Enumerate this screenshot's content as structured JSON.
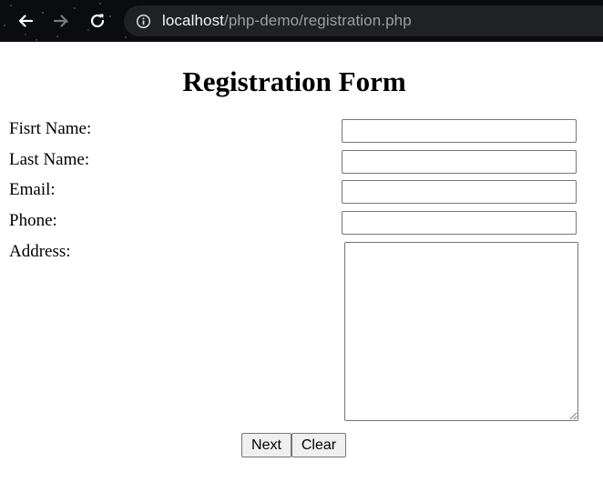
{
  "browser": {
    "url_host": "localhost",
    "url_path": "/php-demo/registration.php"
  },
  "form": {
    "title": "Registration Form",
    "fields": [
      {
        "label": "Fisrt Name:",
        "value": ""
      },
      {
        "label": "Last Name:",
        "value": ""
      },
      {
        "label": "Email:",
        "value": ""
      },
      {
        "label": "Phone:",
        "value": ""
      }
    ],
    "address": {
      "label": "Address:",
      "value": ""
    },
    "buttons": {
      "next": "Next",
      "clear": "Clear"
    }
  },
  "icons": {
    "back": "arrow-left-icon",
    "forward": "arrow-right-icon",
    "reload": "reload-icon",
    "site_info": "info-icon"
  },
  "colors": {
    "toolbar_bg": "#0b0c10",
    "omnibox_bg": "#202124",
    "url_host": "#f1f3f4",
    "url_path": "#9aa0a6",
    "button_bg": "#efefef",
    "input_border": "#767676"
  }
}
